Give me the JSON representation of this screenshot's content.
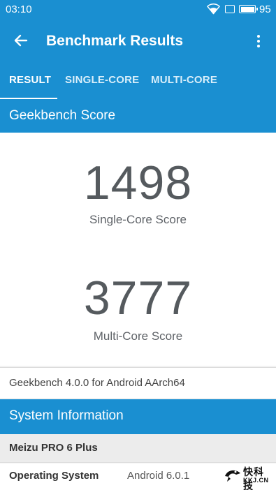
{
  "status_bar": {
    "time": "03:10",
    "battery_level": "95"
  },
  "app_bar": {
    "title": "Benchmark Results",
    "back_icon": "arrow-back-icon",
    "overflow_icon": "more-vert-icon"
  },
  "tabs": [
    {
      "label": "RESULT",
      "active": true
    },
    {
      "label": "SINGLE-CORE",
      "active": false
    },
    {
      "label": "MULTI-CORE",
      "active": false
    }
  ],
  "geekbench": {
    "header": "Geekbench Score",
    "single_core_score": "1498",
    "single_core_label": "Single-Core Score",
    "multi_core_score": "3777",
    "multi_core_label": "Multi-Core Score",
    "version": "Geekbench 4.0.0 for Android AArch64"
  },
  "system_info": {
    "header": "System Information",
    "device": "Meizu PRO 6 Plus",
    "rows": [
      {
        "key": "Operating System",
        "value": "Android 6.0.1"
      }
    ]
  },
  "watermark": {
    "title": "快科技",
    "subtitle": "KKJ.CN"
  },
  "colors": {
    "primary": "#1a8fd1",
    "score_text": "#555a5e"
  }
}
